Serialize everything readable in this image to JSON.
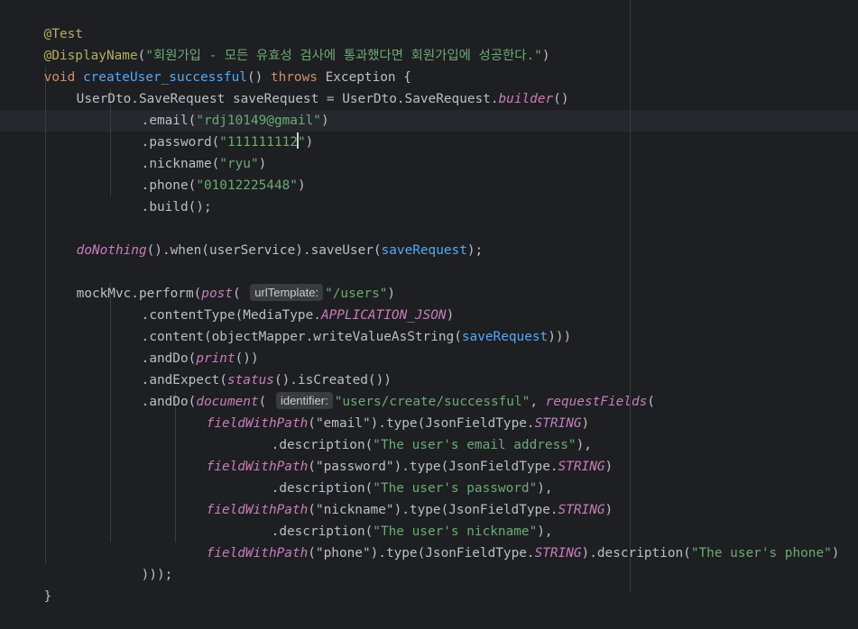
{
  "code": {
    "l1_annotation": "@Test",
    "l2_annotation": "@DisplayName",
    "l2_open": "(",
    "l2_string": "\"회원가입 - 모든 유효성 검사에 통과했다면 회원가입에 성공한다.\"",
    "l2_close": ")",
    "l3_void": "void ",
    "l3_method": "createUser_successful",
    "l3_parens": "() ",
    "l3_throws": "throws ",
    "l3_exception": "Exception {",
    "l4_type": "UserDto.SaveRequest ",
    "l4_var": "saveRequest = ",
    "l4_rhs": "UserDto.SaveRequest.",
    "l4_builder": "builder",
    "l4_end": "()",
    "l5_method": ".email(",
    "l5_arg": "\"rdj10149@gmail\"",
    "l5_end": ")",
    "l6_method": ".password(",
    "l6_arg_a": "\"111111112",
    "l6_arg_b": "\"",
    "l6_end": ")",
    "l7_method": ".nickname(",
    "l7_arg": "\"ryu\"",
    "l7_end": ")",
    "l8_method": ".phone(",
    "l8_arg": "\"01012225448\"",
    "l8_end": ")",
    "l9_method": ".build();",
    "l11_donothing": "doNothing",
    "l11_rest_a": "().when(userService).",
    "l11_save": "saveUser",
    "l11_open": "(",
    "l11_arg": "saveRequest",
    "l11_end": ");",
    "l13_a": "mockMvc.",
    "l13_perform": "perform",
    "l13_open": "(",
    "l13_post": "post",
    "l13_open2": "( ",
    "l13_hint": "urlTemplate:",
    "l13_arg": "\"/users\"",
    "l13_end": ")",
    "l14_a": ".contentType(MediaType.",
    "l14_const": "APPLICATION_JSON",
    "l14_end": ")",
    "l15_a": ".content(objectMapper.",
    "l15_write": "writeValueAsString",
    "l15_open": "(",
    "l15_arg": "saveRequest",
    "l15_end": ")))",
    "l16_a": ".andDo(",
    "l16_print": "print",
    "l16_end": "())",
    "l17_a": ".andExpect(",
    "l17_status": "status",
    "l17_end": "().isCreated())",
    "l18_a": ".andDo(",
    "l18_doc": "document",
    "l18_open": "( ",
    "l18_hint": "identifier:",
    "l18_arg": "\"users/create/successful\"",
    "l18_comma": ", ",
    "l18_req": "requestFields",
    "l18_end": "(",
    "l19_fwp": "fieldWithPath",
    "l19_arg": "(\"email\")",
    "l19_type": ".type(JsonFieldType.",
    "l19_const": "STRING",
    "l19_end": ")",
    "l20_desc": ".description(",
    "l20_arg": "\"The user's email address\"",
    "l20_end": "),",
    "l21_fwp": "fieldWithPath",
    "l21_arg": "(\"password\")",
    "l21_type": ".type(JsonFieldType.",
    "l21_const": "STRING",
    "l21_end": ")",
    "l22_desc": ".description(",
    "l22_arg": "\"The user's password\"",
    "l22_end": "),",
    "l23_fwp": "fieldWithPath",
    "l23_arg": "(\"nickname\")",
    "l23_type": ".type(JsonFieldType.",
    "l23_const": "STRING",
    "l23_end": ")",
    "l24_desc": ".description(",
    "l24_arg": "\"The user's nickname\"",
    "l24_end": "),",
    "l25_fwp": "fieldWithPath",
    "l25_arg": "(\"phone\")",
    "l25_type": ".type(JsonFieldType.",
    "l25_const": "STRING",
    "l25_mid": ").description(",
    "l25_desc": "\"The user's phone\"",
    "l25_end": ")",
    "l26": ")));",
    "l27": "}"
  },
  "colors": {
    "background": "#1e1f22",
    "annotation": "#b3ae60",
    "keyword": "#cf8e6d",
    "method_decl": "#56a8f5",
    "string": "#6aab73",
    "member": "#c77dbb",
    "hint_bg": "#393b41"
  }
}
